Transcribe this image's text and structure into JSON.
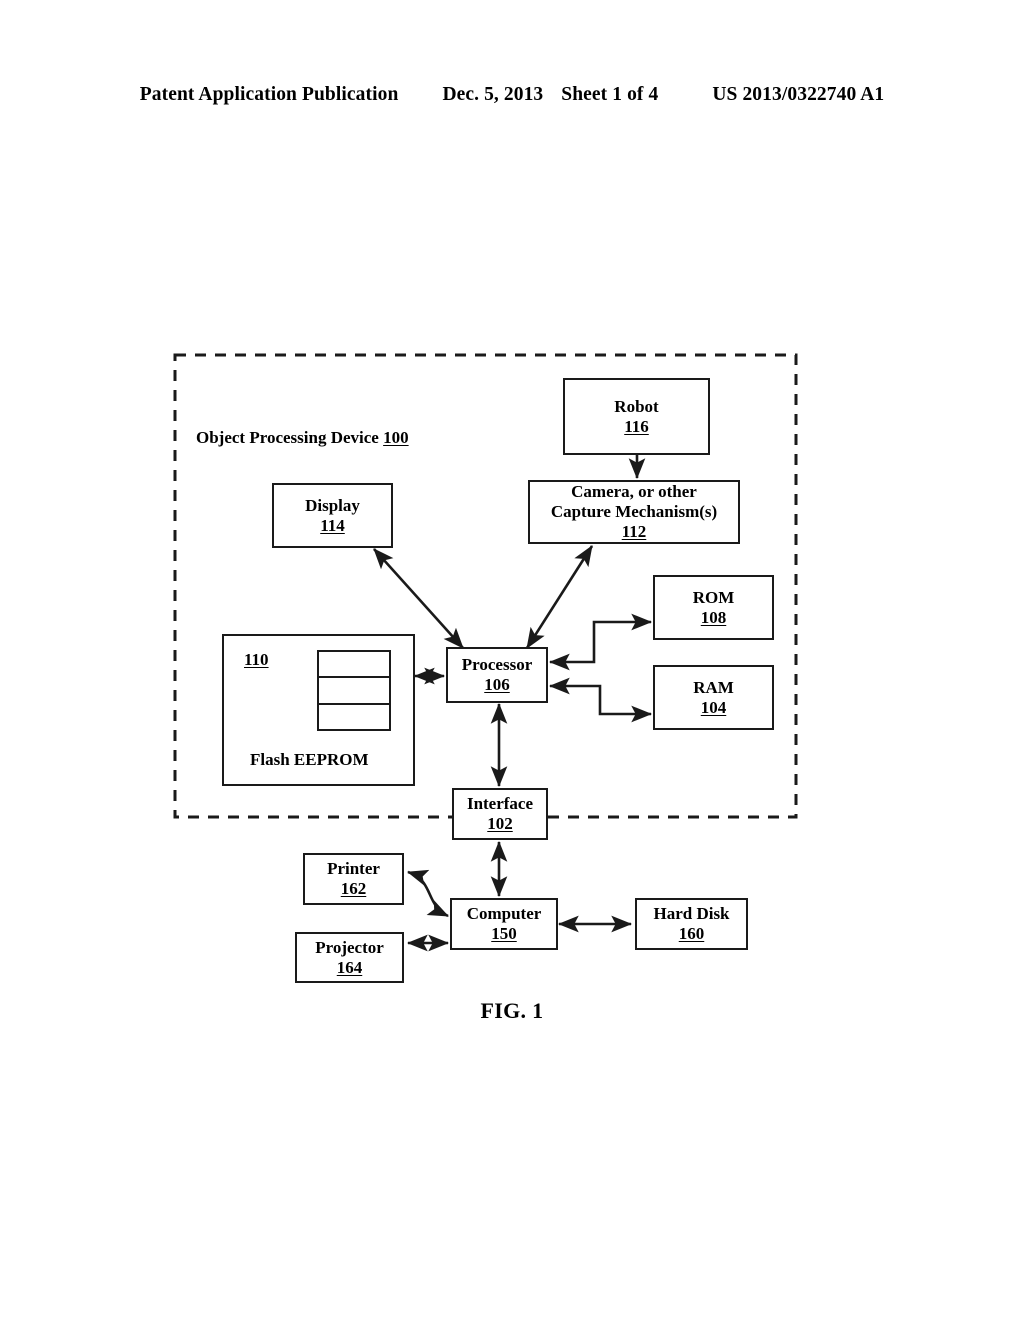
{
  "header": {
    "publication": "Patent Application Publication",
    "date": "Dec. 5, 2013",
    "sheet": "Sheet 1 of 4",
    "patent_number": "US 2013/0322740 A1"
  },
  "figure": {
    "caption": "FIG. 1",
    "enclosure_label": {
      "title": "Object Processing Device",
      "ref": "100"
    },
    "nodes": [
      {
        "id": "robot",
        "title": "Robot",
        "ref": "116"
      },
      {
        "id": "camera",
        "title": "Camera, or other",
        "title2": "Capture Mechanism(s)",
        "ref": "112"
      },
      {
        "id": "display",
        "title": "Display",
        "ref": "114"
      },
      {
        "id": "rom",
        "title": "ROM",
        "ref": "108"
      },
      {
        "id": "ram",
        "title": "RAM",
        "ref": "104"
      },
      {
        "id": "processor",
        "title": "Processor",
        "ref": "106"
      },
      {
        "id": "interface",
        "title": "Interface",
        "ref": "102"
      },
      {
        "id": "computer",
        "title": "Computer",
        "ref": "150"
      },
      {
        "id": "printer",
        "title": "Printer",
        "ref": "162"
      },
      {
        "id": "projector",
        "title": "Projector",
        "ref": "164"
      },
      {
        "id": "harddisk",
        "title": "Hard Disk",
        "ref": "160"
      }
    ],
    "flash_eeprom": {
      "ref": "110",
      "caption": "Flash EEPROM",
      "rows": 3
    },
    "colors": {
      "line": "#1a1a1a",
      "text": "#000000",
      "background": "#ffffff"
    }
  }
}
